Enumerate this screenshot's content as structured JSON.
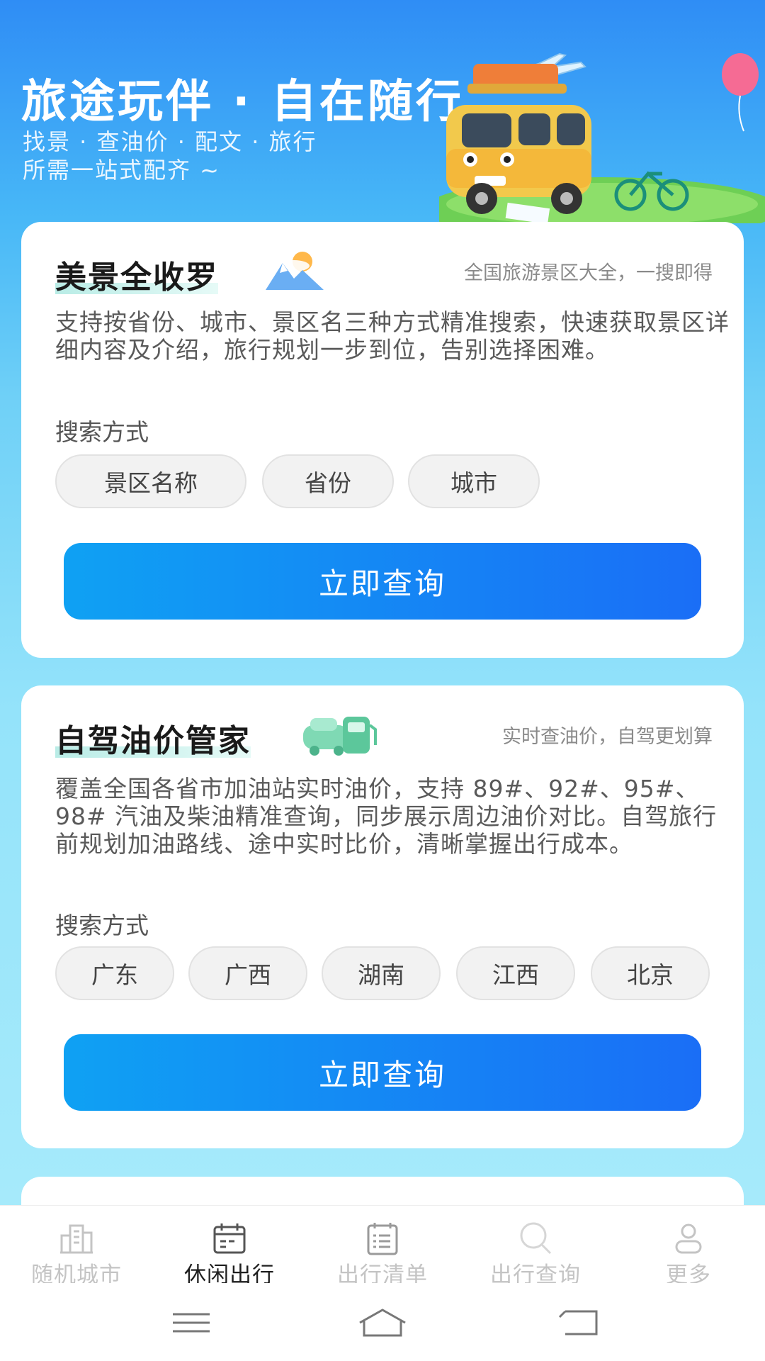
{
  "hero": {
    "title": "旅途玩伴 · 自在随行",
    "subtitle_line1": "找景 · 查油价 · 配文 · 旅行",
    "subtitle_line2": "所需一站式配齐 ~"
  },
  "cards": [
    {
      "title": "美景全收罗",
      "tagline": "全国旅游景区大全，一搜即得",
      "description": "支持按省份、城市、景区名三种方式精准搜索，快速获取景区详细内容及介绍，旅行规划一步到位，告别选择困难。",
      "search_label": "搜索方式",
      "chips": [
        "景区名称",
        "省份",
        "城市"
      ],
      "cta": "立即查询"
    },
    {
      "title": "自驾油价管家",
      "tagline": "实时查油价，自驾更划算",
      "description": "覆盖全国各省市加油站实时油价，支持 89#、92#、95#、98# 汽油及柴油精准查询，同步展示周边油价对比。自驾旅行前规划加油路线、途中实时比价，清晰掌握出行成本。",
      "search_label": "搜索方式",
      "chips": [
        "广东",
        "广西",
        "湖南",
        "江西",
        "北京"
      ],
      "cta": "立即查询"
    }
  ],
  "tabbar": {
    "items": [
      {
        "label": "随机城市",
        "icon": "city-buildings-icon"
      },
      {
        "label": "休闲出行",
        "icon": "calendar-icon"
      },
      {
        "label": "出行清单",
        "icon": "checklist-icon"
      },
      {
        "label": "出行查询",
        "icon": "search-icon"
      },
      {
        "label": "更多",
        "icon": "user-icon"
      }
    ],
    "active": "休闲出行"
  },
  "system_nav": {
    "icons": [
      "menu-icon",
      "home-icon",
      "back-icon"
    ]
  },
  "colors": {
    "primary_blue": "#1a6ef6",
    "accent_blue": "#0fa1f3"
  }
}
